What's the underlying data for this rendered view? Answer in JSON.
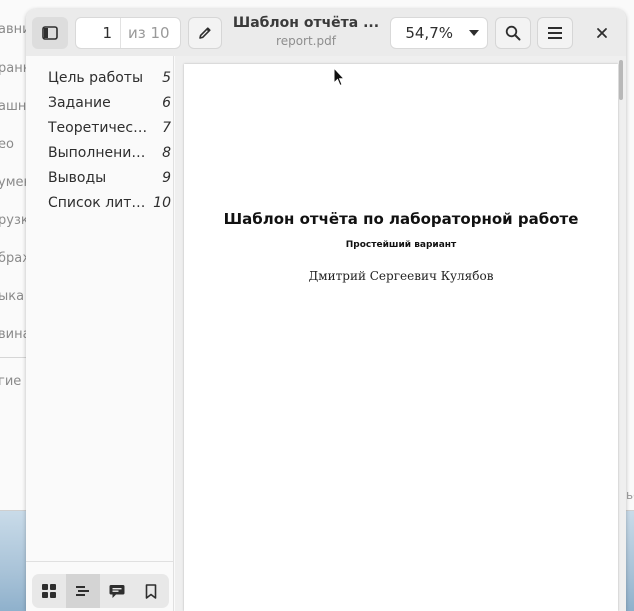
{
  "background_app": {
    "sidebar_items": [
      "авни",
      "ранн",
      "ашн",
      "ео",
      "умен",
      "рузк",
      "браж",
      "ыка",
      "вина",
      "гие м"
    ],
    "right_fragment": "ье"
  },
  "toolbar": {
    "page_current": "1",
    "page_total": "из 10",
    "doc_title": "Шаблон отчёта ...",
    "doc_file": "report.pdf",
    "zoom": "54,7%"
  },
  "outline": [
    {
      "label": "Цель работы",
      "page": "5"
    },
    {
      "label": "Задание",
      "page": "6"
    },
    {
      "label": "Теоретичес…",
      "page": "7"
    },
    {
      "label": "Выполнение…",
      "page": "8"
    },
    {
      "label": "Выводы",
      "page": "9"
    },
    {
      "label": "Список лите…",
      "page": "10"
    }
  ],
  "document": {
    "title": "Шаблон отчёта по лабораторной работе",
    "subtitle": "Простейший вариант",
    "author": "Дмитрий Сергеевич Кулябов"
  },
  "icons": {
    "sidebar_toggle": "sidebar-toggle-icon",
    "annotate": "pencil-icon",
    "search": "search-icon",
    "menu": "hamburger-menu-icon",
    "close": "close-icon",
    "thumbnails": "grid-icon",
    "outline": "outline-list-icon",
    "annotations": "comment-icon",
    "bookmarks": "bookmark-icon"
  }
}
